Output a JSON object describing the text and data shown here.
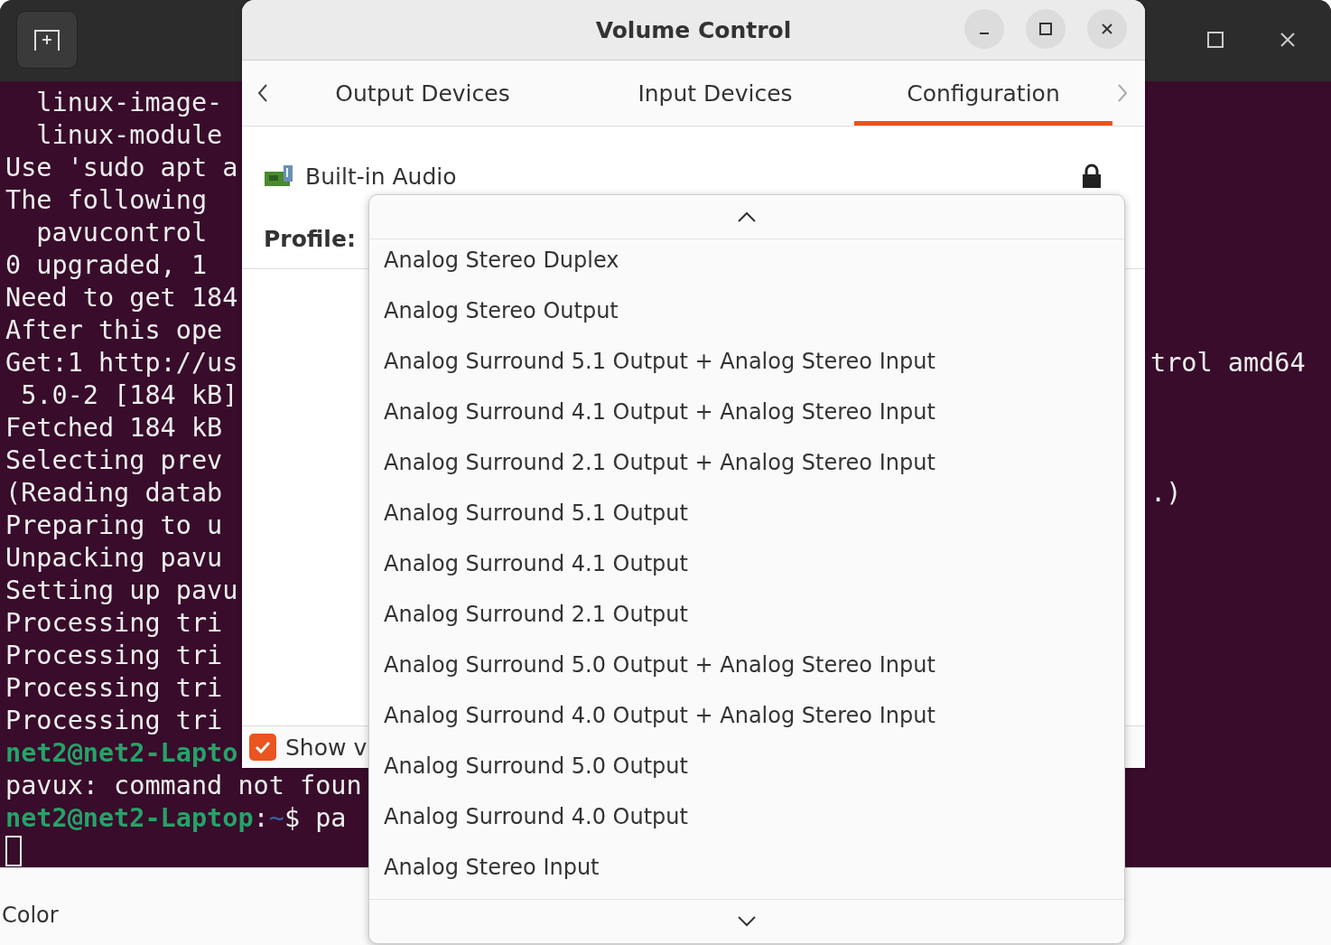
{
  "terminal": {
    "lines": [
      {
        "text": "  linux-image-"
      },
      {
        "text": "  linux-module"
      },
      {
        "text": "Use 'sudo apt a"
      },
      {
        "text": "The following"
      },
      {
        "text": "  pavucontrol"
      },
      {
        "text": "0 upgraded, 1"
      },
      {
        "text": "Need to get 184"
      },
      {
        "text": "After this ope"
      },
      {
        "text": "Get:1 http://us",
        "tail": "trol amd64"
      },
      {
        "text": " 5.0-2 [184 kB]"
      },
      {
        "text": "Fetched 184 kB"
      },
      {
        "text": "Selecting prev"
      },
      {
        "text": "(Reading datab",
        "tail": ".)"
      },
      {
        "text": "Preparing to u"
      },
      {
        "text": "Unpacking pavu"
      },
      {
        "text": "Setting up pavu"
      },
      {
        "text": "Processing tri"
      },
      {
        "text": "Processing tri"
      },
      {
        "text": "Processing tri"
      },
      {
        "text": "Processing tri"
      },
      {
        "prompt": "net2@net2-Lapto"
      },
      {
        "text": "pavux: command not foun"
      },
      {
        "prompt": "net2@net2-Laptop",
        "sep": ":",
        "path": "~",
        "text": "$ pa"
      }
    ]
  },
  "background_window": {
    "label": "Color"
  },
  "volume_control": {
    "title": "Volume Control",
    "tabs": [
      {
        "label": "Output Devices",
        "selected": false
      },
      {
        "label": "Input Devices",
        "selected": false
      },
      {
        "label": "Configuration",
        "selected": true
      }
    ],
    "card": {
      "name": "Built-in Audio",
      "profile_label": "Profile:"
    },
    "footer": {
      "checkbox_label": "Show v",
      "checked": true
    },
    "profile_menu": {
      "items": [
        "Analog Stereo Duplex",
        "Analog Stereo Output",
        "Analog Surround 5.1 Output + Analog Stereo Input",
        "Analog Surround 4.1 Output + Analog Stereo Input",
        "Analog Surround 2.1 Output + Analog Stereo Input",
        "Analog Surround 5.1 Output",
        "Analog Surround 4.1 Output",
        "Analog Surround 2.1 Output",
        "Analog Surround 5.0 Output + Analog Stereo Input",
        "Analog Surround 4.0 Output + Analog Stereo Input",
        "Analog Surround 5.0 Output",
        "Analog Surround 4.0 Output",
        "Analog Stereo Input"
      ]
    }
  }
}
